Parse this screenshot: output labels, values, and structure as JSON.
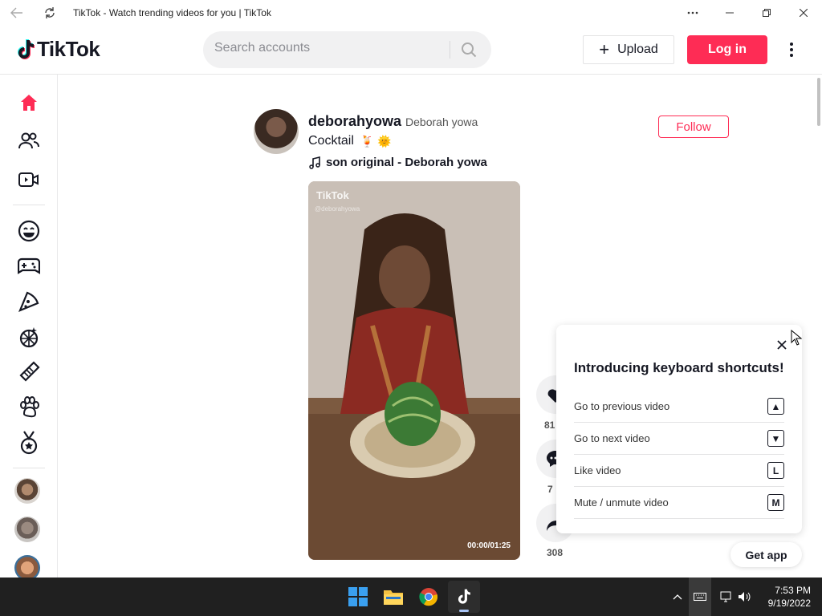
{
  "window": {
    "title": "TikTok - Watch trending videos for you | TikTok"
  },
  "header": {
    "logo_text": "TikTok",
    "search_placeholder": "Search accounts",
    "upload_label": "Upload",
    "login_label": "Log in"
  },
  "sidebar": {
    "items": [
      {
        "icon": "home-icon",
        "label": "For You"
      },
      {
        "icon": "following-icon",
        "label": "Following"
      },
      {
        "icon": "live-icon",
        "label": "LIVE"
      },
      {
        "icon": "comedy-icon",
        "label": "Comedy"
      },
      {
        "icon": "gaming-icon",
        "label": "Gaming"
      },
      {
        "icon": "food-icon",
        "label": "Food"
      },
      {
        "icon": "dance-icon",
        "label": "Dance"
      },
      {
        "icon": "beauty-icon",
        "label": "Beauty"
      },
      {
        "icon": "animals-icon",
        "label": "Animals"
      },
      {
        "icon": "sports-icon",
        "label": "Sports"
      }
    ],
    "accounts": [
      "account-1",
      "account-2",
      "account-3"
    ]
  },
  "post": {
    "username": "deborahyowa",
    "nickname": "Deborah yowa",
    "caption": "Cocktail",
    "caption_emojis": "🍹 🌞",
    "music": "son original - Deborah yowa",
    "follow_label": "Follow",
    "video_watermark": "TikTok",
    "video_watermark_handle": "@deborahyowa",
    "video_time": "00:00/01:25",
    "likes": "81",
    "comments": "7",
    "shares": "308"
  },
  "shortcuts_popup": {
    "title": "Introducing keyboard shortcuts!",
    "rows": [
      {
        "label": "Go to previous video",
        "key": "▲"
      },
      {
        "label": "Go to next video",
        "key": "▼"
      },
      {
        "label": "Like video",
        "key": "L"
      },
      {
        "label": "Mute / unmute video",
        "key": "M"
      }
    ]
  },
  "get_app_label": "Get app",
  "taskbar": {
    "time": "7:53 PM",
    "date": "9/19/2022"
  },
  "colors": {
    "brand": "#fe2c55",
    "text": "#161823",
    "taskbar": "#202020"
  }
}
